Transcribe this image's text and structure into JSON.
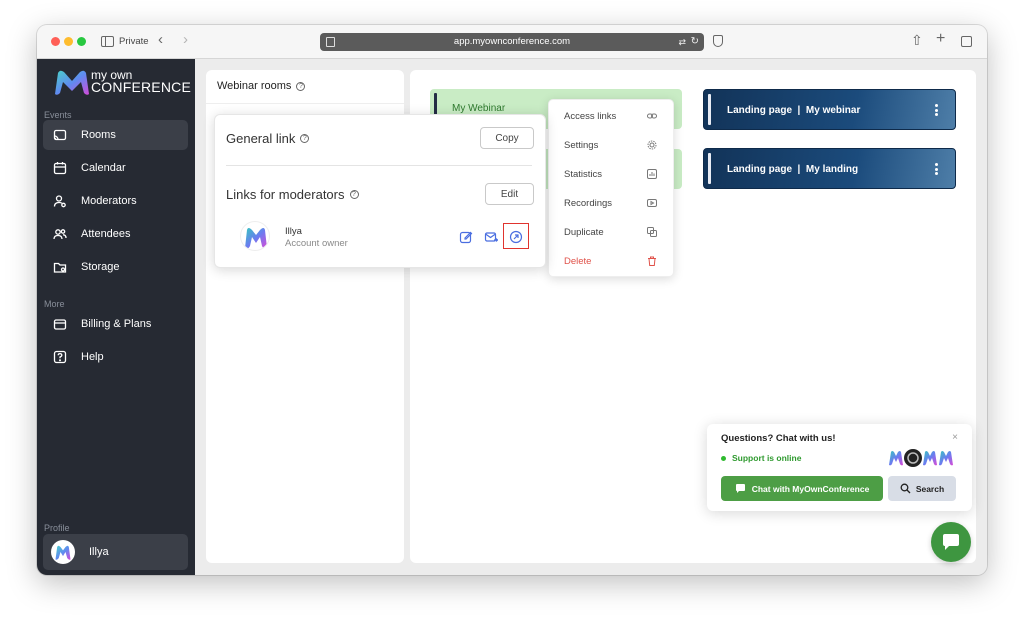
{
  "browser": {
    "private_label": "Private",
    "url": "app.myownconference.com"
  },
  "sidebar": {
    "logo_line1": "my own",
    "logo_line2": "CONFERENCE",
    "events_label": "Events",
    "more_label": "More",
    "profile_label": "Profile",
    "items": [
      {
        "label": "Rooms",
        "icon": "cast-icon",
        "active": true
      },
      {
        "label": "Calendar",
        "icon": "calendar-icon"
      },
      {
        "label": "Moderators",
        "icon": "user-cog-icon"
      },
      {
        "label": "Attendees",
        "icon": "users-icon"
      },
      {
        "label": "Storage",
        "icon": "folder-icon"
      }
    ],
    "more_items": [
      {
        "label": "Billing & Plans",
        "icon": "wallet-icon"
      },
      {
        "label": "Help",
        "icon": "question-icon"
      }
    ],
    "profile_name": "Illya"
  },
  "rooms_panel": {
    "title": "Webinar rooms"
  },
  "rooms": [
    {
      "name": "My Webinar",
      "style": "green"
    },
    {
      "name": "",
      "style": "green"
    }
  ],
  "landing_pages": [
    {
      "name": "Landing page  |  My webinar"
    },
    {
      "name": "Landing page  |  My landing"
    }
  ],
  "dropdown": {
    "items": [
      {
        "label": "Access links",
        "icon": "link-icon"
      },
      {
        "label": "Settings",
        "icon": "gear-icon"
      },
      {
        "label": "Statistics",
        "icon": "chart-icon"
      },
      {
        "label": "Recordings",
        "icon": "play-icon"
      },
      {
        "label": "Duplicate",
        "icon": "copy-icon"
      },
      {
        "label": "Delete",
        "icon": "trash-icon",
        "danger": true
      }
    ]
  },
  "links_popover": {
    "general_title": "General link",
    "copy_label": "Copy",
    "moderators_title": "Links for moderators",
    "edit_label": "Edit",
    "moderator": {
      "name": "Illya",
      "role": "Account owner"
    }
  },
  "chat": {
    "title": "Questions? Chat with us!",
    "status": "Support is online",
    "primary_label": "Chat with MyOwnConference",
    "secondary_label": "Search",
    "close": "×"
  },
  "colors": {
    "sidebar_bg": "#262a33",
    "accent_green": "#4d9e45",
    "danger": "#e0524a",
    "highlight": "#e0342e"
  }
}
